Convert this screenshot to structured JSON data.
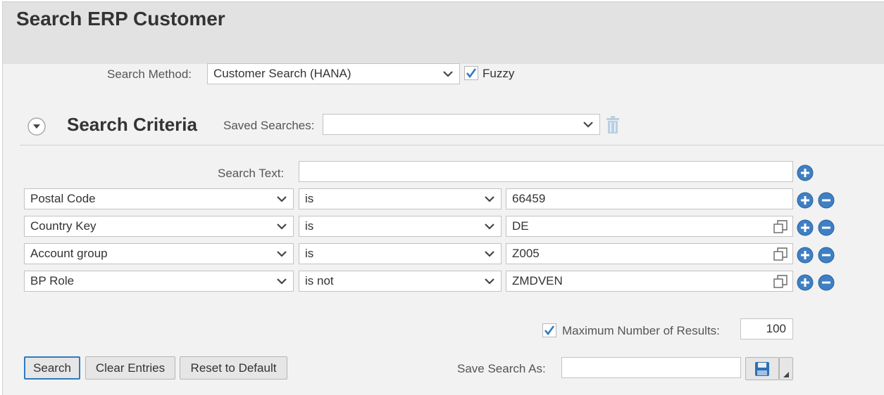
{
  "page": {
    "title": "Search ERP Customer"
  },
  "search_method": {
    "label": "Search Method:",
    "value": "Customer Search (HANA)",
    "fuzzy_label": "Fuzzy",
    "fuzzy_checked": true
  },
  "criteria": {
    "title": "Search Criteria",
    "saved_searches_label": "Saved Searches:",
    "saved_searches_value": "",
    "search_text_label": "Search Text:",
    "search_text_value": "",
    "rows": [
      {
        "field": "Postal Code",
        "operator": "is",
        "value": "66459",
        "has_value_help": false
      },
      {
        "field": "Country Key",
        "operator": "is",
        "value": "DE",
        "has_value_help": true
      },
      {
        "field": "Account group",
        "operator": "is",
        "value": "Z005",
        "has_value_help": true
      },
      {
        "field": "BP Role",
        "operator": "is not",
        "value": "ZMDVEN",
        "has_value_help": true
      }
    ]
  },
  "max_results": {
    "label": "Maximum Number of Results:",
    "checked": true,
    "value": "100"
  },
  "actions": {
    "search": "Search",
    "clear": "Clear Entries",
    "reset": "Reset to Default",
    "save_as_label": "Save Search As:",
    "save_as_value": ""
  },
  "colors": {
    "accent": "#2f7bbf",
    "header_bg": "#e2e2e2",
    "panel_bg": "#f2f2f2",
    "icon_blue": "#3f7fc4"
  }
}
